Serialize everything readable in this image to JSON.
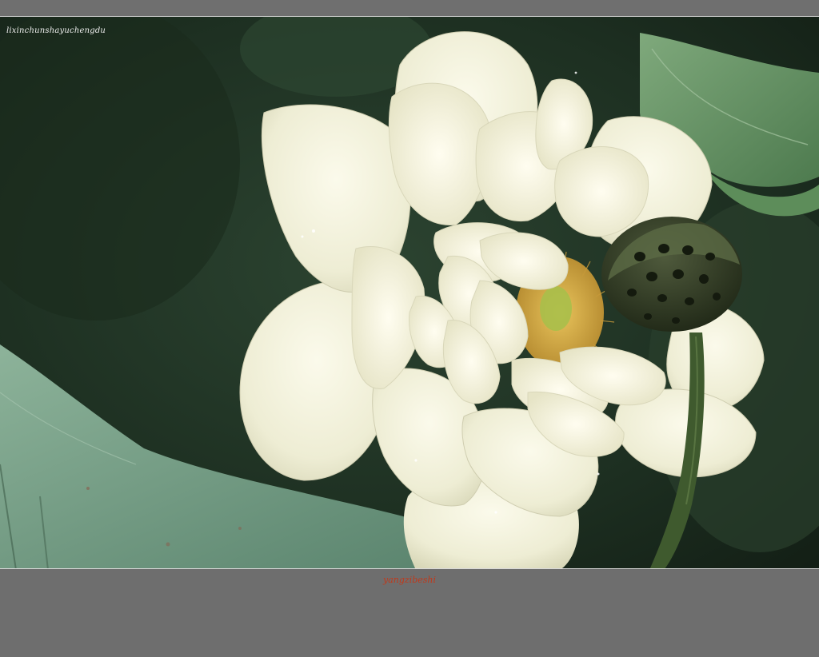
{
  "photo": {
    "subject": "white lotus flower",
    "watermark_top_left": "lixinchunshayuchengdu",
    "signature_bottom": "yangzibeshi"
  },
  "colors": {
    "frame_gray": "#6e6e6e",
    "background_green": "#1f3322",
    "petal_white": "#efeed6",
    "stamen_yellow": "#d9b24c",
    "leaf_green": "#6f9a7a",
    "signature_red": "#c0391b"
  }
}
